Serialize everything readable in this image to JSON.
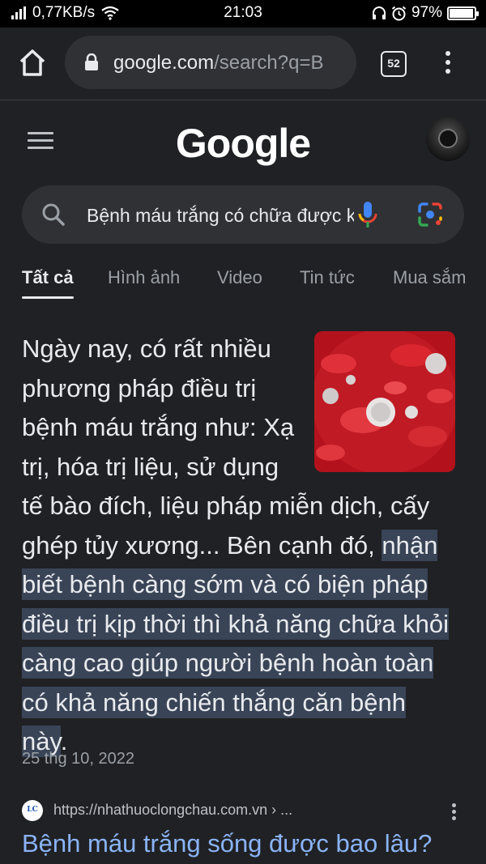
{
  "status_bar": {
    "network_speed": "0,77KB/s",
    "time": "21:03",
    "battery_percent": "97%",
    "battery_level": 0.97,
    "icons": [
      "signal-icon",
      "wifi-icon",
      "headphones-icon",
      "alarm-icon",
      "battery-icon"
    ]
  },
  "browser": {
    "url_domain": "google.com",
    "url_path": "/search?q=B",
    "tab_count": "52",
    "icons": [
      "home-icon",
      "lock-icon",
      "tabs-icon",
      "more-vert-icon"
    ]
  },
  "google": {
    "logo": "Google",
    "search_query": "Bệnh máu trắng có chữa được không",
    "icons": [
      "hamburger-icon",
      "avatar",
      "search-icon",
      "mic-icon",
      "lens-icon"
    ]
  },
  "tabs": [
    {
      "label": "Tất cả",
      "active": true
    },
    {
      "label": "Hình ảnh",
      "active": false
    },
    {
      "label": "Video",
      "active": false
    },
    {
      "label": "Tin tức",
      "active": false
    },
    {
      "label": "Mua sắm",
      "active": false
    }
  ],
  "snippet": {
    "text_plain": "Ngày nay, có rất nhiều phương pháp điều trị bệnh máu trắng như: Xạ trị, hóa trị liệu, sử dụng tế bào đích, liệu pháp miễn dịch, cấy ghép tủy xương... Bên cạnh đó, ",
    "text_highlight": "nhận biết bệnh càng sớm và có biện pháp điều trị kịp thời thì khả năng chữa khỏi càng cao giúp người bệnh hoàn toàn có khả năng chiến thắng căn bệnh này",
    "text_end": ".",
    "date": "25 thg 10, 2022",
    "highlight_color": "#394457"
  },
  "result": {
    "url": "https://nhathuoclongchau.com.vn › ...",
    "favicon_text": "LC",
    "title": "Bệnh máu trắng sống được bao lâu?",
    "title_color": "#8ab4f8"
  }
}
